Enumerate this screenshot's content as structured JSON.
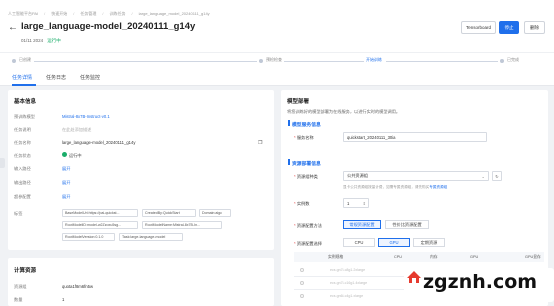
{
  "breadcrumbs": [
    "人工智能平台PAI",
    "快速开始",
    "任务管理",
    "训练任务",
    "large_language_model_20240111_g14y"
  ],
  "header": {
    "title": "large_language-model_20240111_g14y",
    "date": "01/11 2024",
    "status": "运行中",
    "buttons": {
      "tensorboard": "Tensorboard",
      "stop": "停止",
      "delete": "删除"
    }
  },
  "steps": [
    "已创建",
    "预检检查",
    "开始训练",
    "已完成"
  ],
  "tabs": [
    "任务详情",
    "任务日志",
    "任务监控"
  ],
  "basic": {
    "title": "基本信息",
    "rows": [
      {
        "label": "预训练模型",
        "value": "Mistral-8x7B-Instruct-v0.1"
      },
      {
        "label": "任务说明",
        "value": "在此处添加描述"
      },
      {
        "label": "任务名称",
        "value": "large_language-model_20240111_g14y"
      },
      {
        "label": "任务状态",
        "value": "运行中"
      },
      {
        "label": "输入路径",
        "value": "展开"
      },
      {
        "label": "输出路径",
        "value": "展开"
      },
      {
        "label": "超参配置",
        "value": "展开"
      },
      {
        "label": "标签",
        "value": ""
      }
    ],
    "tags": [
      "BaseModelUri:https://pai-quickst...",
      "CreatedBy:QuickStart",
      "Domain:aigc",
      "RootModelID:model-w2Zzoxu5sg...",
      "RootModelName:Mistral-8x7B-In...",
      "RootModelVersion:0.1.0",
      "Task:large-language-model"
    ]
  },
  "compute": {
    "title": "计算资源",
    "rows": [
      {
        "label": "资源组",
        "value": "quota1f8m6fn5w"
      },
      {
        "label": "数量",
        "value": "1"
      }
    ]
  },
  "deploy": {
    "title": "模型部署",
    "desc": "将您训练好的模型部署为在线服务，以进行实时的模型调用。",
    "service_section": "模型服务信息",
    "service_name_label": "服务名称",
    "service_name_value": "quickstart_20240111_30ia",
    "resource_section": "资源部署信息",
    "resource_type_label": "资源组种类",
    "resource_type_value": "公共资源组",
    "resource_hint": "显卡公共资源组按量计费，如需专属资源组，请先购买",
    "resource_hint_link": "专属资源组",
    "instances_label": "实例数",
    "instances_value": "1",
    "config_method_label": "资源配置方法",
    "config_method_options": [
      "常规资源配置",
      "性价比资源配置"
    ],
    "config_select_label": "资源配置选择",
    "config_select_options": [
      "CPU",
      "GPU",
      "定期资源"
    ],
    "table_headers": [
      "实例规格",
      "CPU",
      "内存",
      "GPU",
      "GPU显存"
    ],
    "table_rows": [
      "ecs.gn7i-c8g1.2xlarge",
      "ecs.gn7i-c16g1.4xlarge",
      "ecs.gn6i-c4g1.xlarge"
    ]
  },
  "watermark": "zgznh.com",
  "colors": {
    "accent": "#1f6feb",
    "success": "#1aad6a"
  }
}
